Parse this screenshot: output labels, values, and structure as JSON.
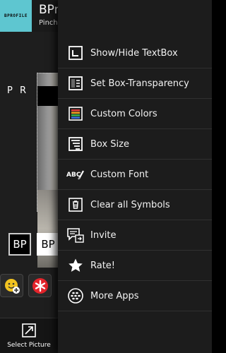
{
  "app": {
    "logo_text": "BPROFILE",
    "title": "BPr",
    "subtitle": "Pinch"
  },
  "canvas": {
    "preview_text": "P R"
  },
  "toolbar": {
    "bp_label_1": "BP",
    "bp_label_2": "BP"
  },
  "bottom": {
    "select_picture_label": "Select Picture"
  },
  "menu": {
    "items": [
      {
        "label": "Show/Hide TextBox",
        "icon": "textbox-icon"
      },
      {
        "label": "Set Box-Transparency",
        "icon": "transparency-icon"
      },
      {
        "label": "Custom Colors",
        "icon": "colors-icon"
      },
      {
        "label": "Box Size",
        "icon": "box-size-icon"
      },
      {
        "label": "Custom Font",
        "icon": "font-icon"
      },
      {
        "label": "Clear all Symbols",
        "icon": "trash-icon"
      },
      {
        "label": "Invite",
        "icon": "invite-icon"
      },
      {
        "label": "Rate!",
        "icon": "star-icon"
      },
      {
        "label": "More Apps",
        "icon": "bbm-icon"
      }
    ]
  }
}
